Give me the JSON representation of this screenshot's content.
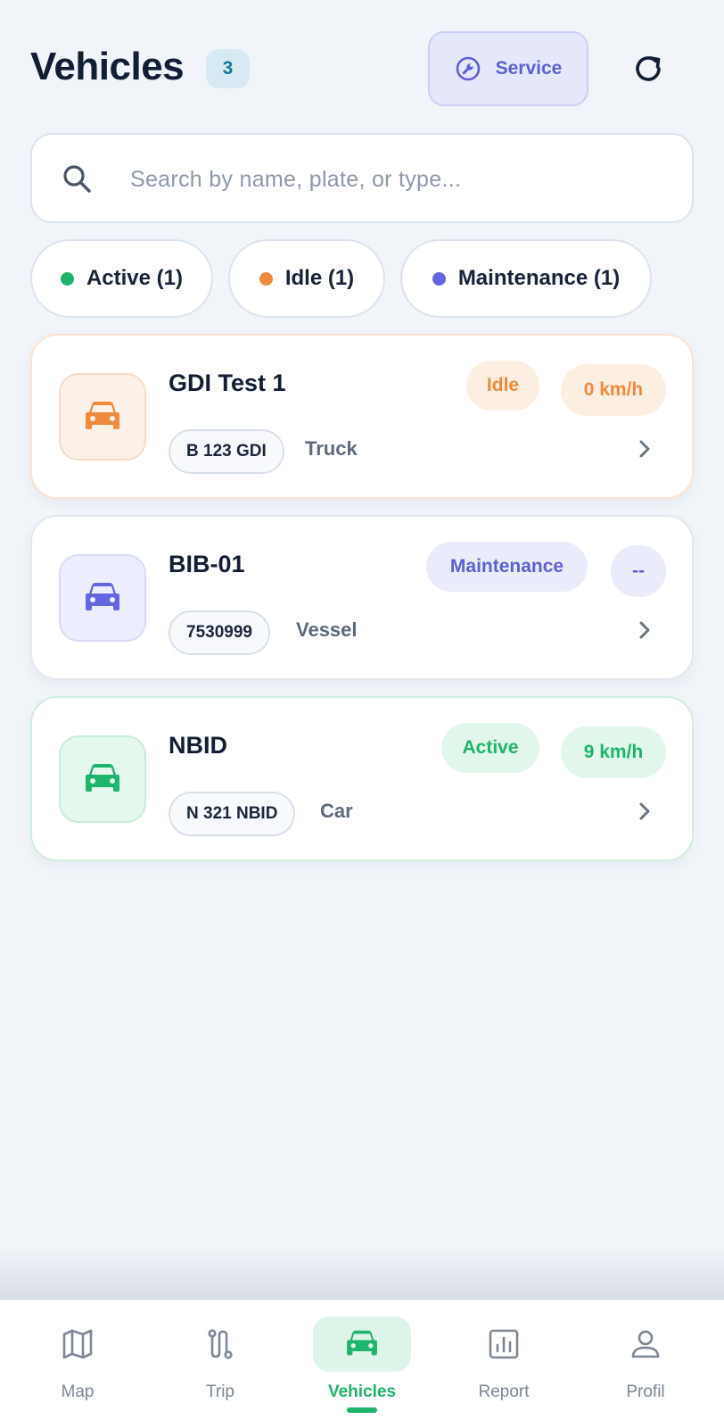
{
  "header": {
    "title": "Vehicles",
    "count": "3",
    "service_label": "Service"
  },
  "search": {
    "placeholder": "Search by name, plate, or type..."
  },
  "filters": [
    {
      "label": "Active (1)",
      "color": "#1eb46b"
    },
    {
      "label": "Idle (1)",
      "color": "#f08a3c"
    },
    {
      "label": "Maintenance (1)",
      "color": "#6366e0"
    }
  ],
  "vehicles": [
    {
      "name": "GDI Test 1",
      "plate": "B 123 GDI",
      "type": "Truck",
      "status": "Idle",
      "speed": "0 km/h",
      "icon": "car-icon",
      "color": "#f08a3c"
    },
    {
      "name": "BIB-01",
      "plate": "7530999",
      "type": "Vessel",
      "status": "Maintenance",
      "speed": "--",
      "icon": "car-icon",
      "color": "#6366e0"
    },
    {
      "name": "NBID",
      "plate": "N 321 NBID",
      "type": "Car",
      "status": "Active",
      "speed": "9 km/h",
      "icon": "car-icon",
      "color": "#1eb46b"
    }
  ],
  "nav": [
    {
      "label": "Map",
      "icon": "map-icon"
    },
    {
      "label": "Trip",
      "icon": "route-icon"
    },
    {
      "label": "Vehicles",
      "icon": "car-icon",
      "selected": true
    },
    {
      "label": "Report",
      "icon": "report-icon"
    },
    {
      "label": "Profil",
      "icon": "user-icon"
    }
  ]
}
